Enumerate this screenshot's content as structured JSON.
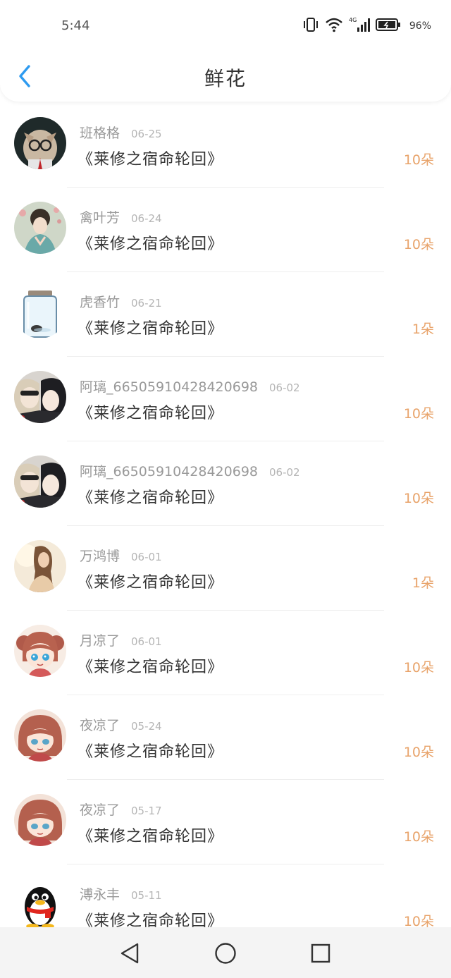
{
  "status_bar": {
    "time": "5:44",
    "battery": "96%",
    "network": "4G"
  },
  "header": {
    "title": "鲜花",
    "back_icon": "chevron-left-icon"
  },
  "colors": {
    "accent": "#2e9bf0",
    "amount": "#e8a36a",
    "name": "#999999",
    "title": "#333333"
  },
  "records": [
    {
      "name": "班格格",
      "date": "06-25",
      "book": "《莱修之宿命轮回》",
      "amount": "10朵",
      "avatar": "cat-avatar"
    },
    {
      "name": "禽叶芳",
      "date": "06-24",
      "book": "《莱修之宿命轮回》",
      "amount": "10朵",
      "avatar": "lady-avatar"
    },
    {
      "name": "虎香竹",
      "date": "06-21",
      "book": "《莱修之宿命轮回》",
      "amount": "1朵",
      "avatar": "jar-avatar"
    },
    {
      "name": "阿璃_66505910428420698",
      "date": "06-02",
      "book": "《莱修之宿命轮回》",
      "amount": "10朵",
      "avatar": "anime-duo-avatar"
    },
    {
      "name": "阿璃_66505910428420698",
      "date": "06-02",
      "book": "《莱修之宿命轮回》",
      "amount": "10朵",
      "avatar": "anime-duo-avatar"
    },
    {
      "name": "万鸿博",
      "date": "06-01",
      "book": "《莱修之宿命轮回》",
      "amount": "1朵",
      "avatar": "girl-photo-avatar"
    },
    {
      "name": "月凉了",
      "date": "06-01",
      "book": "《莱修之宿命轮回》",
      "amount": "10朵",
      "avatar": "chibi-girl-avatar"
    },
    {
      "name": "夜凉了",
      "date": "05-24",
      "book": "《莱修之宿命轮回》",
      "amount": "10朵",
      "avatar": "chibi-girl-avatar"
    },
    {
      "name": "夜凉了",
      "date": "05-17",
      "book": "《莱修之宿命轮回》",
      "amount": "10朵",
      "avatar": "chibi-girl-avatar"
    },
    {
      "name": "溥永丰",
      "date": "05-11",
      "book": "《莱修之宿命轮回》",
      "amount": "10朵",
      "avatar": "qq-penguin-avatar"
    }
  ],
  "system_nav": {
    "back": "triangle-back-icon",
    "home": "circle-home-icon",
    "recents": "square-recents-icon"
  }
}
